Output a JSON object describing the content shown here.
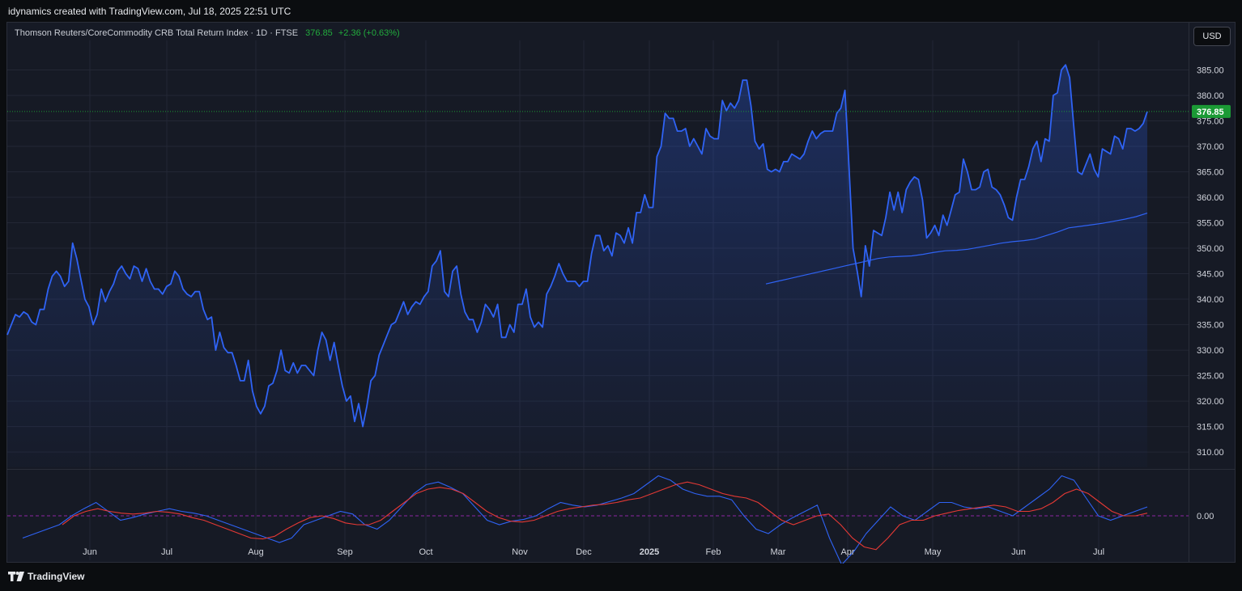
{
  "header": {
    "credit": "idynamics created with TradingView.com, Jul 18, 2025 22:51 UTC"
  },
  "legend": {
    "symbol": "Thomson Reuters/CoreCommodity CRB Total Return Index · 1D · FTSE",
    "last": "376.85",
    "change": "+2.36 (+0.63%)"
  },
  "currency_button": "USD",
  "last_price_badge": "376.85",
  "indicator_zero_label": "0.00",
  "footer": {
    "brand": "TradingView"
  },
  "colors": {
    "price_line": "#2f63f5",
    "ma_line": "#2f63f5",
    "signal_line": "#e53935",
    "macd_line": "#2f63f5",
    "badge": "#1b9a35"
  },
  "chart_data": [
    {
      "type": "area",
      "ylim": [
        307,
        390
      ],
      "y_ticks": [
        "310.00",
        "315.00",
        "320.00",
        "325.00",
        "330.00",
        "335.00",
        "340.00",
        "345.00",
        "350.00",
        "355.00",
        "360.00",
        "365.00",
        "370.00",
        "375.00",
        "380.00",
        "385.00"
      ],
      "x_ticks": [
        "Jun",
        "Jul",
        "Aug",
        "Sep",
        "Oct",
        "Nov",
        "Dec",
        "2025",
        "Feb",
        "Mar",
        "Apr",
        "May",
        "Jun",
        "Jul"
      ],
      "series": [
        {
          "values": [
            333,
            335,
            337,
            336.5,
            337.5,
            337,
            335.5,
            335,
            338,
            338,
            342,
            344.5,
            345.5,
            344.5,
            342.5,
            343.5,
            351,
            348,
            344,
            340,
            338.5,
            335,
            337,
            342,
            339.5,
            341.5,
            343,
            345.5,
            346.5,
            345,
            344,
            346.5,
            346,
            343.5,
            346,
            343.5,
            342,
            342,
            341,
            342.5,
            343,
            345.5,
            344.5,
            342,
            341,
            340.5,
            341.5,
            341.5,
            338,
            336,
            336.5,
            330,
            333.5,
            330.5,
            329.5,
            329.5,
            327,
            324,
            324,
            328,
            322,
            319,
            317.5,
            319,
            323,
            323.5,
            326,
            330,
            326,
            325.5,
            327.5,
            325.5,
            327,
            327,
            326,
            325,
            330,
            333.5,
            332,
            328,
            331.5,
            327,
            323,
            320,
            321,
            316,
            319.5,
            315,
            319,
            324,
            325,
            329,
            331,
            333,
            335,
            335.5,
            337.5,
            339.5,
            337,
            338.5,
            339.5,
            339,
            340.5,
            341.5,
            346.5,
            347.5,
            349.5,
            341.5,
            340.5,
            345.5,
            346.5,
            341,
            337.5,
            336,
            336,
            333.5,
            335.5,
            339,
            338,
            336.5,
            339,
            332.5,
            332.5,
            335,
            333.5,
            339,
            339,
            342,
            336.5,
            334.5,
            335.5,
            334.5,
            341,
            342.5,
            344.5,
            347,
            345,
            343.5,
            343.5,
            343.5,
            342.5,
            343.5,
            343.5,
            349,
            352.5,
            352.5,
            349.5,
            350.5,
            348.5,
            353,
            352.5,
            351,
            354,
            351,
            357,
            357,
            360.5,
            358,
            358,
            368,
            370,
            376.5,
            375.5,
            375.5,
            373,
            373,
            373.5,
            370,
            371.5,
            370,
            368.5,
            373.5,
            372,
            371.5,
            371.5,
            379,
            377,
            378.5,
            377.5,
            379,
            383,
            383,
            378,
            371,
            369.5,
            370.5,
            365.5,
            365,
            365.5,
            365,
            367,
            367,
            368.5,
            368,
            367.5,
            368.5,
            371,
            373,
            371.5,
            372.5,
            373,
            373,
            373,
            376.5,
            377.5,
            381,
            366,
            350,
            345.5,
            340.5,
            350.5,
            346.5,
            353.5,
            353,
            352.5,
            356,
            361,
            357.5,
            361,
            357,
            361.5,
            363,
            364,
            363.5,
            359.5,
            352,
            353,
            354.5,
            352.5,
            356.5,
            354.5,
            357.5,
            360.5,
            361,
            367.5,
            365,
            361.5,
            361.5,
            362,
            365,
            365.5,
            362,
            361.5,
            360.5,
            358.5,
            356,
            355.5,
            360,
            363.5,
            363.5,
            366,
            369.5,
            371,
            367,
            371.5,
            371,
            380,
            380.5,
            385,
            386,
            383.5,
            374,
            365,
            364.5,
            366.5,
            368.5,
            365.5,
            364,
            369.5,
            369,
            368.5,
            372,
            371.5,
            369.5,
            373.5,
            373.5,
            373,
            373.5,
            374.5,
            376.85
          ]
        },
        {
          "values": [
            343,
            343.5,
            344,
            344.5,
            345,
            345.5,
            346,
            346.5,
            347,
            347.5,
            348,
            348.3,
            348.4,
            348.5,
            348.8,
            349.2,
            349.5,
            349.6,
            349.8,
            350.2,
            350.6,
            351,
            351.3,
            351.5,
            351.8,
            352.5,
            353.2,
            354,
            354.3,
            354.6,
            354.9,
            355.3,
            355.7,
            356.2,
            356.9
          ]
        }
      ]
    },
    {
      "type": "line",
      "ylim": [
        -5,
        5
      ],
      "y_ticks": [
        "0.00"
      ],
      "series": [
        {
          "values": [
            -2.5,
            -2,
            -1.5,
            -1,
            0,
            0.8,
            1.5,
            0.5,
            -0.5,
            -0.2,
            0.2,
            0.5,
            0.8,
            0.5,
            0.3,
            0,
            -0.5,
            -1,
            -1.5,
            -2,
            -2.5,
            -3,
            -2.5,
            -1,
            -0.5,
            0,
            0.5,
            0.2,
            -1,
            -1.5,
            -0.5,
            1,
            2.5,
            3.5,
            3.8,
            3.2,
            2.5,
            1,
            -0.5,
            -1,
            -0.6,
            -0.4,
            0,
            0.8,
            1.5,
            1.2,
            1,
            1.2,
            1.6,
            2,
            2.5,
            3.5,
            4.5,
            4,
            3,
            2.5,
            2.2,
            2.2,
            1.8,
            0,
            -1.5,
            -2,
            -1,
            -0.2,
            0.5,
            1.2,
            -2.5,
            -5.5,
            -4,
            -2,
            -0.5,
            1,
            0,
            -0.5,
            0.5,
            1.5,
            1.5,
            1,
            0.8,
            1,
            0.5,
            0,
            1,
            2,
            3,
            4.5,
            4,
            2,
            0,
            -0.5,
            0,
            0.5,
            1
          ]
        },
        {
          "values": [
            -1,
            0,
            0.5,
            0.8,
            0.5,
            0.3,
            0.2,
            0.3,
            0.5,
            0.4,
            0.2,
            -0.2,
            -0.5,
            -1,
            -1.5,
            -2,
            -2.5,
            -2.6,
            -2.3,
            -1.5,
            -0.8,
            -0.2,
            0,
            -0.3,
            -0.8,
            -1,
            -1,
            -0.5,
            0.5,
            1.5,
            2.5,
            3,
            3.2,
            3,
            2.5,
            1.5,
            0.5,
            -0.2,
            -0.6,
            -0.7,
            -0.5,
            0,
            0.5,
            0.8,
            1,
            1.2,
            1.3,
            1.5,
            1.8,
            2,
            2.5,
            3,
            3.5,
            3.8,
            3.5,
            3,
            2.5,
            2.2,
            2,
            1.5,
            0.5,
            -0.5,
            -1,
            -0.5,
            0,
            0.2,
            -1,
            -2.5,
            -3.5,
            -3.8,
            -2.5,
            -1,
            -0.5,
            -0.5,
            0,
            0.3,
            0.6,
            0.8,
            1,
            1.2,
            1,
            0.5,
            0.5,
            0.8,
            1.5,
            2.5,
            3,
            2.5,
            1.5,
            0.5,
            0,
            0,
            0.3
          ]
        }
      ]
    }
  ]
}
